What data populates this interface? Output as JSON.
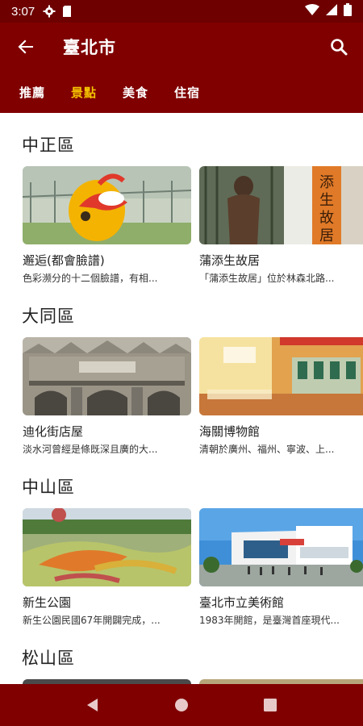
{
  "status_bar": {
    "time": "3:07"
  },
  "app_bar": {
    "title": "臺北市"
  },
  "tabs": [
    {
      "label": "推薦",
      "active": false
    },
    {
      "label": "景點",
      "active": true
    },
    {
      "label": "美食",
      "active": false
    },
    {
      "label": "住宿",
      "active": false
    }
  ],
  "sections": [
    {
      "title": "中正區",
      "cards": [
        {
          "name": "邂逅(都會臉譜)",
          "desc": "色彩濒分的十二個臉譜，有相..."
        },
        {
          "name": "蒲添生故居",
          "desc": "「蒲添生故居」位於林森北路..."
        }
      ]
    },
    {
      "title": "大同區",
      "cards": [
        {
          "name": "迪化街店屋",
          "desc": "淡水河曾經是條既深且廣的大..."
        },
        {
          "name": "海關博物館",
          "desc": "清朝於廣州、福州、寧波、上..."
        }
      ]
    },
    {
      "title": "中山區",
      "cards": [
        {
          "name": "新生公園",
          "desc": "新生公園民國67年開闢完成，..."
        },
        {
          "name": "臺北市立美術館",
          "desc": "1983年開館，是臺灣首座現代..."
        }
      ]
    },
    {
      "title": "松山區",
      "cards": []
    }
  ],
  "colors": {
    "primary": "#800000",
    "status_bar": "#6e0000",
    "active_tab": "#f5c400"
  },
  "icons": {
    "back": "arrow-left-icon",
    "search": "search-icon",
    "nav_back": "triangle-back-icon",
    "nav_home": "circle-home-icon",
    "nav_recents": "square-recents-icon"
  }
}
